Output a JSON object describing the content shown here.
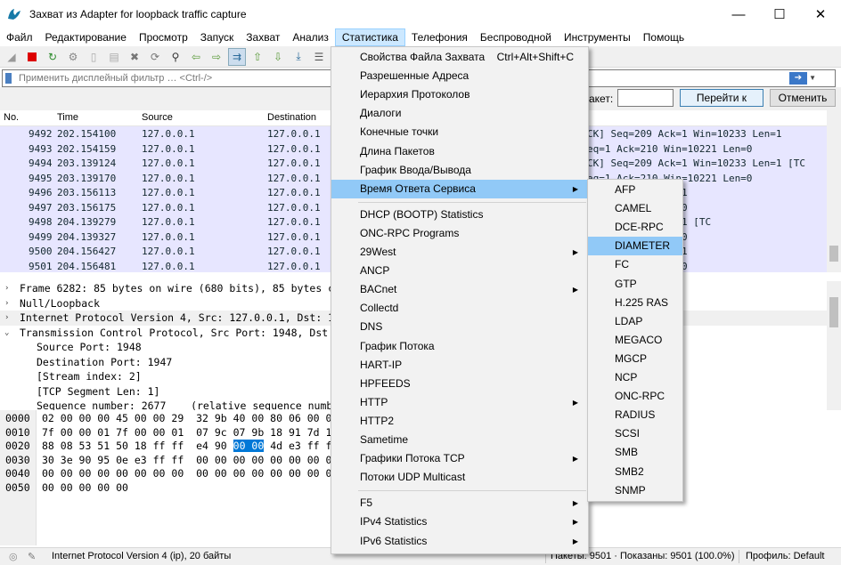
{
  "window": {
    "title": "Захват из Adapter for loopback traffic capture"
  },
  "menu": [
    "Файл",
    "Редактирование",
    "Просмотр",
    "Запуск",
    "Захват",
    "Анализ",
    "Статистика",
    "Телефония",
    "Беспроводной",
    "Инструменты",
    "Помощь"
  ],
  "filter": {
    "placeholder": "Применить дисплейный фильтр … <Ctrl-/>"
  },
  "goto": {
    "label": "акет:",
    "button": "Перейти к пакету",
    "cancel": "Отменить"
  },
  "packet_list": {
    "columns": [
      "No.",
      "Time",
      "Source",
      "Destination"
    ],
    "rows": [
      {
        "no": "9492",
        "time": "202.154100",
        "src": "127.0.0.1",
        "dst": "127.0.0.1",
        "info": "CK] Seq=209 Ack=1 Win=10233 Len=1"
      },
      {
        "no": "9493",
        "time": "202.154159",
        "src": "127.0.0.1",
        "dst": "127.0.0.1",
        "info": "eq=1 Ack=210 Win=10221 Len=0"
      },
      {
        "no": "9494",
        "time": "203.139124",
        "src": "127.0.0.1",
        "dst": "127.0.0.1",
        "info": "CK] Seq=209 Ack=1 Win=10233 Len=1 [TC"
      },
      {
        "no": "9495",
        "time": "203.139170",
        "src": "127.0.0.1",
        "dst": "127.0.0.1",
        "info": "eq=1 Ack=210 Win=10221 Len=0"
      },
      {
        "no": "9496",
        "time": "203.156113",
        "src": "127.0.0.1",
        "dst": "127.0.0.1",
        "info": "] Win=10233 Len=1"
      },
      {
        "no": "9497",
        "time": "203.156175",
        "src": "127.0.0.1",
        "dst": "127.0.0.1",
        "info": "] Win=10221 Len=0"
      },
      {
        "no": "9498",
        "time": "204.139279",
        "src": "127.0.0.1",
        "dst": "127.0.0.1",
        "info": "] Win=10233 Len=1 [TC"
      },
      {
        "no": "9499",
        "time": "204.139327",
        "src": "127.0.0.1",
        "dst": "127.0.0.1",
        "info": "] Win=10221 Len=0"
      },
      {
        "no": "9500",
        "time": "204.156427",
        "src": "127.0.0.1",
        "dst": "127.0.0.1",
        "info": "] Win=10233 Len=1"
      },
      {
        "no": "9501",
        "time": "204.156481",
        "src": "127.0.0.1",
        "dst": "127.0.0.1",
        "info": "] Win=10221 Len=0"
      }
    ]
  },
  "details": [
    {
      "tw": "›",
      "text": "Frame 6282: 85 bytes on wire (680 bits), 85 bytes ca"
    },
    {
      "tw": "›",
      "text": "Null/Loopback"
    },
    {
      "tw": "›",
      "text": "Internet Protocol Version 4, Src: 127.0.0.1, Dst: 12"
    },
    {
      "tw": "⌄",
      "text": "Transmission Control Protocol, Src Port: 1948, Dst P"
    },
    {
      "tw": "",
      "text": "Source Port: 1948"
    },
    {
      "tw": "",
      "text": "Destination Port: 1947"
    },
    {
      "tw": "",
      "text": "[Stream index: 2]"
    },
    {
      "tw": "",
      "text": "[TCP Segment Len: 1]"
    },
    {
      "tw": "",
      "text": "Sequence number: 2677    (relative sequence numbe"
    }
  ],
  "hex": {
    "offsets": [
      "0000",
      "0010",
      "0020",
      "0030",
      "0040",
      "0050"
    ],
    "rows": [
      {
        "pre": "02 00 00 00 45 00 00 29  32 9b 40 00 80 06 00 00",
        "hl": "",
        "post": ""
      },
      {
        "pre": "7f 00 00 01 7f 00 00 01  07 9c 07 9b 18 91 7d 16",
        "hl": "",
        "post": ""
      },
      {
        "pre": "88 08 53 51 50 18 ff ff  e4 90 ",
        "hl": "00 00",
        "post": " 4d e3 ff ff"
      },
      {
        "pre": "30 3e 90 95 0e e3 ff ff  00 00 00 00 00 00 00 00",
        "hl": "",
        "post": ""
      },
      {
        "pre": "00 00 00 00 00 00 00 00  00 00 00 00 00 00 00 00",
        "hl": "",
        "post": ""
      },
      {
        "pre": "00 00 00 00 00",
        "hl": "",
        "post": ""
      }
    ]
  },
  "status": {
    "left": "Internet Protocol Version 4 (ip), 20 байты",
    "packets": "Пакеты: 9501 · Показаны: 9501 (100.0%)",
    "profile": "Профиль: Default"
  },
  "stats_menu": {
    "items": [
      {
        "label": "Свойства Файла Захвата",
        "shortcut": "Ctrl+Alt+Shift+C",
        "arrow": false
      },
      {
        "label": "Разрешенные Адреса",
        "shortcut": "",
        "arrow": false
      },
      {
        "label": "Иерархия Протоколов",
        "shortcut": "",
        "arrow": false
      },
      {
        "label": "Диалоги",
        "shortcut": "",
        "arrow": false
      },
      {
        "label": "Конечные точки",
        "shortcut": "",
        "arrow": false
      },
      {
        "label": "Длина Пакетов",
        "shortcut": "",
        "arrow": false
      },
      {
        "label": "График Ввода/Вывода",
        "shortcut": "",
        "arrow": false
      },
      {
        "label": "Время Ответа Сервиса",
        "shortcut": "",
        "arrow": true
      },
      {
        "label": "DHCP (BOOTP) Statistics",
        "shortcut": "",
        "arrow": false
      },
      {
        "label": "ONC-RPC Programs",
        "shortcut": "",
        "arrow": false
      },
      {
        "label": "29West",
        "shortcut": "",
        "arrow": true
      },
      {
        "label": "ANCP",
        "shortcut": "",
        "arrow": false
      },
      {
        "label": "BACnet",
        "shortcut": "",
        "arrow": true
      },
      {
        "label": "Collectd",
        "shortcut": "",
        "arrow": false
      },
      {
        "label": "DNS",
        "shortcut": "",
        "arrow": false
      },
      {
        "label": "График Потока",
        "shortcut": "",
        "arrow": false
      },
      {
        "label": "HART-IP",
        "shortcut": "",
        "arrow": false
      },
      {
        "label": "HPFEEDS",
        "shortcut": "",
        "arrow": false
      },
      {
        "label": "HTTP",
        "shortcut": "",
        "arrow": true
      },
      {
        "label": "HTTP2",
        "shortcut": "",
        "arrow": false
      },
      {
        "label": "Sametime",
        "shortcut": "",
        "arrow": false
      },
      {
        "label": "Графики Потока TCP",
        "shortcut": "",
        "arrow": true
      },
      {
        "label": "Потоки UDP Multicast",
        "shortcut": "",
        "arrow": false
      },
      {
        "label": "F5",
        "shortcut": "",
        "arrow": true
      },
      {
        "label": "IPv4 Statistics",
        "shortcut": "",
        "arrow": true
      },
      {
        "label": "IPv6 Statistics",
        "shortcut": "",
        "arrow": true
      }
    ]
  },
  "srt_submenu": [
    "AFP",
    "CAMEL",
    "DCE-RPC",
    "DIAMETER",
    "FC",
    "GTP",
    "H.225 RAS",
    "LDAP",
    "MEGACO",
    "MGCP",
    "NCP",
    "ONC-RPC",
    "RADIUS",
    "SCSI",
    "SMB",
    "SMB2",
    "SNMP"
  ]
}
